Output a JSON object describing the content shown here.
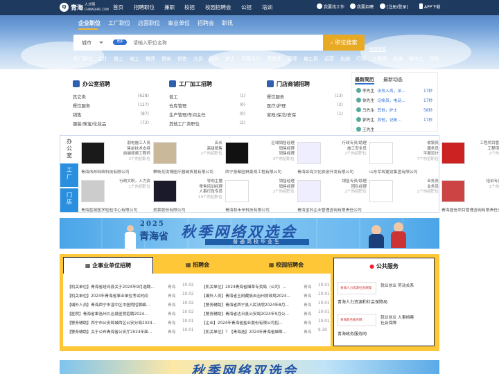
{
  "brand": {
    "name": "青海",
    "sub": "人才网",
    "domain": "CHINAQHRC.COM"
  },
  "nav": [
    "首页",
    "招聘职位",
    "兼职",
    "校招",
    "校园招聘会",
    "公招",
    "培训"
  ],
  "tools": {
    "find_job": "我要找工作",
    "hire": "我要招聘",
    "login": "[注册/登录]",
    "app": "APP下载"
  },
  "tabs": [
    "企业职位",
    "工厂职位",
    "店面职位",
    "事业单位",
    "招聘会",
    "职讯"
  ],
  "search": {
    "city": "城市",
    "pill": "更多",
    "placeholder": "请输入职位名称",
    "button": "职位搜索",
    "advanced": "高级搜索"
  },
  "hot": {
    "label": "热门职位：",
    "items": [
      "会计",
      "普工",
      "电工",
      "教师",
      "保安",
      "销售",
      "文员",
      "财务",
      "护士",
      "平面设计",
      "建造师",
      "厨师",
      "施工员",
      "运营",
      "出纳",
      "行政",
      "工程师",
      "机械",
      "操作工",
      "消防"
    ]
  },
  "categories": [
    {
      "title": "办公室招聘",
      "rows": [
        [
          "其它类",
          "(628)"
        ],
        [
          "餐饮服务",
          "(127)"
        ],
        [
          "销售",
          "(87)"
        ],
        [
          "服装/珠宝/化妆品",
          "(72)"
        ]
      ]
    },
    {
      "title": "工厂加工招聘",
      "rows": [
        [
          "普工",
          "(1)"
        ],
        [
          "仓库管理",
          "(0)"
        ],
        [
          "生产管理/车间主任",
          "(0)"
        ],
        [
          "其他工厂类职位",
          "(2)"
        ]
      ]
    },
    {
      "title": "门店商铺招聘",
      "rows": [
        [
          "餐饮服务",
          "(13)"
        ],
        [
          "医疗/护理",
          "(2)"
        ],
        [
          "家政/保洁/安保",
          "(1)"
        ],
        [
          "",
          ""
        ]
      ]
    }
  ],
  "news": {
    "tabs": [
      "最新简历",
      "最新动态"
    ],
    "rows": [
      {
        "n": "李先生",
        "a": "法务人员，法...",
        "t": "17秒"
      },
      {
        "n": "徐先生",
        "a": "记帐员，电话...",
        "t": "17秒"
      },
      {
        "n": "马先生",
        "a": "其他，护士",
        "t": "58秒"
      },
      {
        "n": "郭先生",
        "a": "其他，记帐...",
        "t": "17秒"
      },
      {
        "n": "王先生",
        "a": "",
        "t": ""
      }
    ]
  },
  "ent_tabs": [
    "办公室",
    "工厂",
    "门店"
  ],
  "companies": [
    {
      "jobs": [
        "弱电施工人员",
        "售前技术支持",
        "前端视频工程师"
      ],
      "more": "3个热招职位",
      "name": "青海伟邦网络科技有限公司"
    },
    {
      "jobs": [
        "店长",
        "高级销售"
      ],
      "more": "2个热招职位",
      "name": "攀枝花珑博医疗器械贸易有限公司"
    },
    {
      "jobs": [
        "区域销售经理",
        "销售经理",
        "销售经理"
      ],
      "more": "3个热招职位",
      "name": "西宁意都园林景观工程有限公司"
    },
    {
      "jobs": [
        "行政专员/助理",
        "施工安全员"
      ],
      "more": "2个热招职位",
      "name": "青海如海文化旅游开发有限公司"
    },
    {
      "jobs": [
        "收银员",
        "服务员",
        "平面设计"
      ],
      "more": "7个热招职位",
      "name": "山东军辉建设集团有限公司"
    },
    {
      "jobs": [
        "工程项目管理（企",
        "工程项目管理"
      ],
      "more": "2个热招职位",
      "name": ""
    },
    {
      "jobs": [
        "行政文职，人力资"
      ],
      "more": "1个热招职位",
      "name": "青海蓝城医学检验中心有限公司"
    },
    {
      "jobs": [
        "导购主播",
        "零售培训经理",
        "人事行政专员"
      ],
      "more": "19个热招职位",
      "name": "爱慕股份有限公司"
    },
    {
      "jobs": [
        "销售经理",
        "销售经理"
      ],
      "more": "2个热招职位",
      "name": "青海和禾米科技有限公司"
    },
    {
      "jobs": [
        "销售专员/助理",
        "团队经理"
      ],
      "more": "2个热招职位",
      "name": "青海宝科企业管理咨询有限责任公司"
    },
    {
      "jobs": [
        "业务员",
        "业务员"
      ],
      "more": "2个热招职位",
      "name": ""
    },
    {
      "jobs": [
        "培训专员/助理"
      ],
      "more": "1个热招职位",
      "name": "青海盛信项目管理咨询有限责任公司"
    }
  ],
  "banner": {
    "year": "2025",
    "province": "青海省",
    "main": "秋季网络双选会",
    "sub": "普通高校毕业生"
  },
  "fair": {
    "tabs": [
      "企事业单位招聘",
      "招聘会",
      "校园招聘会"
    ],
    "left": [
      {
        "t": "【机关单位】青海省班玛县关于2024年9月选聘...",
        "p": "青海",
        "d": "10-02",
        "hot": true
      },
      {
        "t": "【机关单位】2024年青海省事业单位考试时间",
        "p": "青海",
        "d": "10-02",
        "hot": true
      },
      {
        "t": "【编外人员】青海西宁市湟中区中医院招聘编...",
        "p": "青海",
        "d": "10-02",
        "hot": true
      },
      {
        "t": "【医院】青海省果洛州久治县医院招聘2024...",
        "p": "青海",
        "d": "10-02",
        "hot": true
      },
      {
        "t": "【警务辅助】西宁市公安局城西区公安分局2024...",
        "p": "青海",
        "d": "10-01",
        "hot": false
      },
      {
        "t": "【警务辅助】关于公布青海省公安厅2024年面...",
        "p": "青海",
        "d": "10-01",
        "hot": false
      }
    ],
    "right": [
      {
        "t": "【机关单位】2024青海省烟草专卖局（公司）...",
        "p": "青海",
        "d": "10-01"
      },
      {
        "t": "【编外人员】青海省玉树藏族自治州财政局2024...",
        "p": "青海",
        "d": "10-01"
      },
      {
        "t": "【警务辅助】青海省西宁县人民法院2024年8月...",
        "p": "青海",
        "d": "10-01"
      },
      {
        "t": "【警务辅助】青海省达日县公安局2024年9月公...",
        "p": "青海",
        "d": "10-01"
      },
      {
        "t": "【企业】2024年青海省盐业股份有限公司招...",
        "p": "青海",
        "d": "10-01"
      },
      {
        "t": "【机关单位】？【青海选】2024年青海省烟草...",
        "p": "青海",
        "d": "9-30"
      }
    ]
  },
  "public": {
    "title": "公共服务",
    "items": [
      {
        "img": "青海人力资源社会保障",
        "txt1": "就业创业  劳动关系",
        "txt2": "",
        "name": "青海人力资源和社会保障局"
      },
      {
        "img": "青海政务服务网",
        "txt1": "就业创业  人事档案",
        "txt2": "社会保障",
        "name": "青海政务服务网"
      }
    ]
  },
  "colors": {
    "accent": "#2f6fd2",
    "search_btn": "#e8a923",
    "fair_bg": "#fec737"
  }
}
